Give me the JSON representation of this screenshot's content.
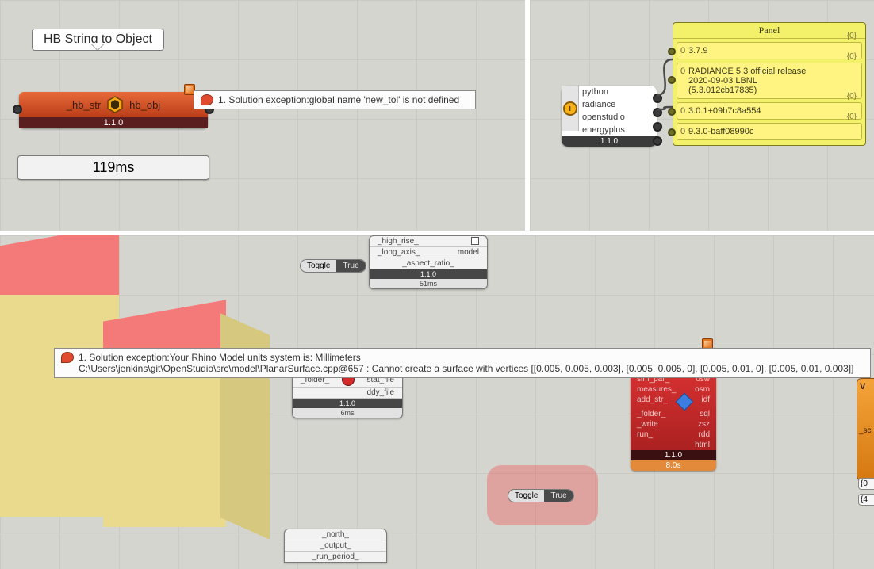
{
  "tl": {
    "label": "HB String to Object",
    "in": "_hb_str",
    "out": "hb_obj",
    "version": "1.1.0",
    "time": "119ms",
    "error": "1. Solution exception:global name 'new_tol' is not defined"
  },
  "tr": {
    "info": {
      "params": [
        "python",
        "radiance",
        "openstudio",
        "energyplus"
      ],
      "version": "1.1.0"
    },
    "panel": {
      "title": "Panel",
      "groups": [
        {
          "idx": "{0}",
          "lines": [
            "3.7.9"
          ]
        },
        {
          "idx": "{0}",
          "lines": [
            "RADIANCE 5.3 official release",
            "2020-09-03 LBNL",
            "(5.3.012cb17835)"
          ]
        },
        {
          "idx": "{0}",
          "lines": [
            "3.0.1+09b7c8a554"
          ]
        },
        {
          "idx": "{0}",
          "lines": [
            "9.3.0-baff08990c"
          ]
        }
      ]
    }
  },
  "b": {
    "error_line1": "1. Solution exception:Your Rhino Model units system is: Millimeters",
    "error_line2": "C:\\Users\\jenkins\\git\\OpenStudio\\src\\model\\PlanarSurface.cpp@657 : Cannot create a surface with vertices [[0.005, 0.005, 0.003], [0.005, 0.005, 0], [0.005, 0.01, 0], [0.005, 0.01, 0.003]]",
    "model": {
      "params": [
        "_high_rise_",
        "_long_axis_",
        "_aspect_ratio_"
      ],
      "out": "model",
      "version": "1.1.0",
      "time": "51ms"
    },
    "toggle1": {
      "label": "Toggle",
      "value": "True"
    },
    "toggle2": {
      "label": "Toggle",
      "value": "True"
    },
    "epw": {
      "params": [
        "stat_file",
        "ddy_file"
      ],
      "left": "_folder_",
      "version": "1.1.0",
      "time": "6ms"
    },
    "north": {
      "params": [
        "_north_",
        "_output_",
        "_run_period_"
      ]
    },
    "redc": {
      "left": [
        "sim_par_",
        "measures_",
        "add_str_",
        "_folder_",
        "_write",
        "run_"
      ],
      "right": [
        "osw",
        "osm",
        "idf",
        "sql",
        "zsz",
        "rdd",
        "html"
      ],
      "version": "1.1.0",
      "time": "8.0s"
    },
    "side": {
      "label": "_sc"
    },
    "counts": [
      "{0",
      "{4"
    ]
  }
}
